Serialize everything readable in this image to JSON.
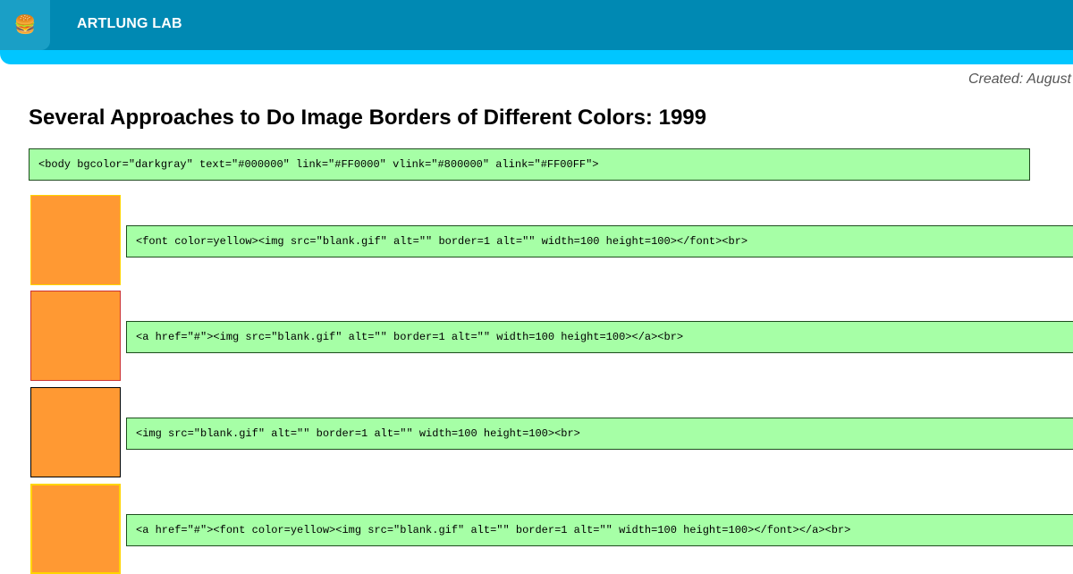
{
  "header": {
    "brand": "ARTLUNG LAB",
    "logo_glyph": "🍔",
    "header_color": "#0089b3",
    "accent_color": "#00c6ff"
  },
  "meta": {
    "created": "Created: August"
  },
  "page": {
    "title": "Several Approaches to Do Image Borders of Different Colors: 1999",
    "body_code": "<body bgcolor=\"darkgray\" text=\"#000000\" link=\"#FF0000\" vlink=\"#800000\" alink=\"#FF00FF\">"
  },
  "examples": [
    {
      "code": "<font color=yellow><img src=\"blank.gif\" alt=\"\" border=1 alt=\"\" width=100 height=100></font><br>",
      "border_color": "#ffd400"
    },
    {
      "code": "<a href=\"#\"><img src=\"blank.gif\" alt=\"\" border=1 alt=\"\" width=100 height=100></a><br>",
      "border_color": "#cc3333"
    },
    {
      "code": "<img src=\"blank.gif\" alt=\"\" border=1 alt=\"\" width=100 height=100><br>",
      "border_color": "#000000"
    },
    {
      "code": "<a href=\"#\"><font color=yellow><img src=\"blank.gif\" alt=\"\" border=1 alt=\"\" width=100 height=100></font></a><br>",
      "border_color": "#ffd400"
    }
  ],
  "colors": {
    "swatch_fill": "#ff9933",
    "code_bg": "#a6ffa6"
  }
}
